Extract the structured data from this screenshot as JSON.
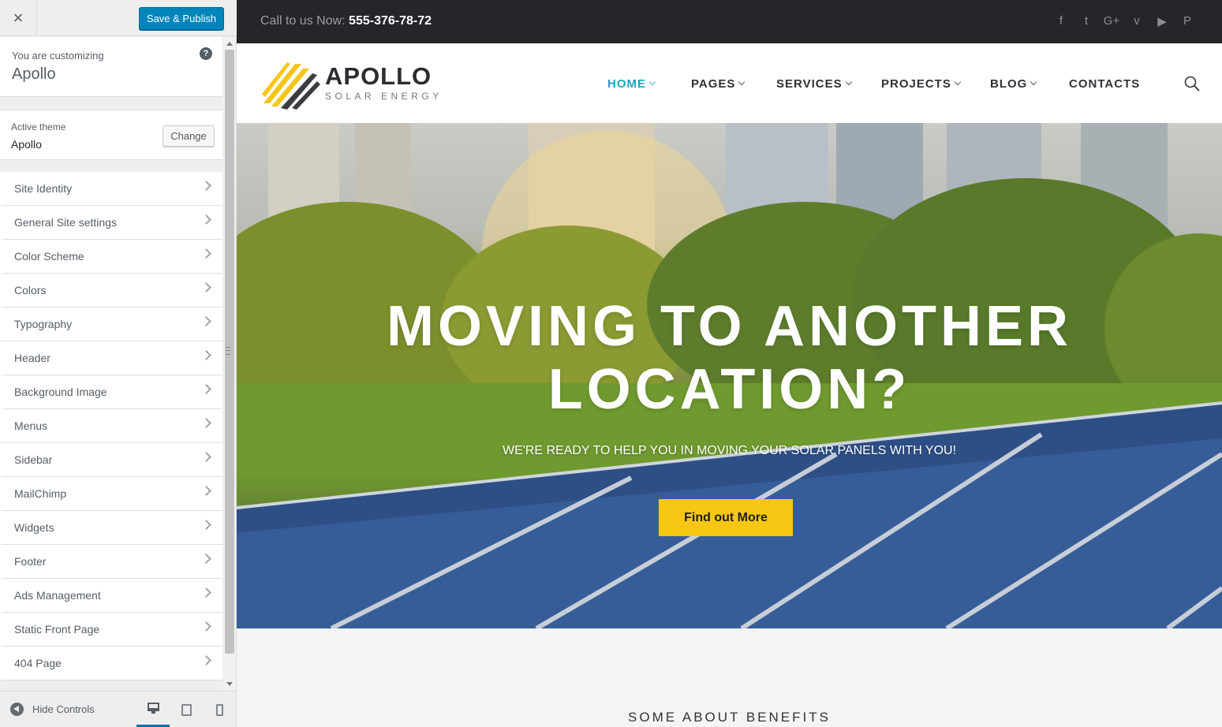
{
  "customizer": {
    "close_glyph": "×",
    "save_label": "Save & Publish",
    "customizing_label": "You are customizing",
    "site_name": "Apollo",
    "help_glyph": "?",
    "active_theme_label": "Active theme",
    "active_theme_name": "Apollo",
    "change_label": "Change",
    "sections": [
      "Site Identity",
      "General Site settings",
      "Color Scheme",
      "Colors",
      "Typography",
      "Header",
      "Background Image",
      "Menus",
      "Sidebar",
      "MailChimp",
      "Widgets",
      "Footer",
      "Ads Management",
      "Static Front Page",
      "404 Page"
    ],
    "hide_controls_label": "Hide Controls",
    "devices": [
      "desktop",
      "tablet",
      "mobile"
    ],
    "active_device": "desktop",
    "accent_color": "#0085ba"
  },
  "preview": {
    "topbar": {
      "call_label": "Call to us Now:",
      "phone": "555-376-78-72",
      "social_icons": [
        "facebook-icon",
        "twitter-icon",
        "google-plus-icon",
        "vimeo-icon",
        "youtube-icon",
        "pinterest-icon"
      ],
      "social_glyphs": [
        "f",
        "t",
        "G+",
        "v",
        "▶",
        "P"
      ]
    },
    "logo": {
      "title": "APOLLO",
      "subtitle": "SOLAR ENERGY"
    },
    "nav": [
      {
        "label": "HOME",
        "dropdown": true,
        "active": true
      },
      {
        "label": "PAGES",
        "dropdown": true,
        "active": false
      },
      {
        "label": "SERVICES",
        "dropdown": true,
        "active": false
      },
      {
        "label": "PROJECTS",
        "dropdown": true,
        "active": false
      },
      {
        "label": "BLOG",
        "dropdown": true,
        "active": false
      },
      {
        "label": "CONTACTS",
        "dropdown": false,
        "active": false
      }
    ],
    "hero": {
      "title_line1": "MOVING TO ANOTHER",
      "title_line2": "LOCATION?",
      "subtitle": "WE'RE READY TO HELP YOU IN MOVING YOUR SOLAR PANELS WITH YOU!",
      "cta_label": "Find out More"
    },
    "section_heading": "SOME ABOUT BENEFITS",
    "colors": {
      "nav_active": "#1fa3c4",
      "cta": "#f7c713",
      "topbar": "#24262a"
    }
  }
}
